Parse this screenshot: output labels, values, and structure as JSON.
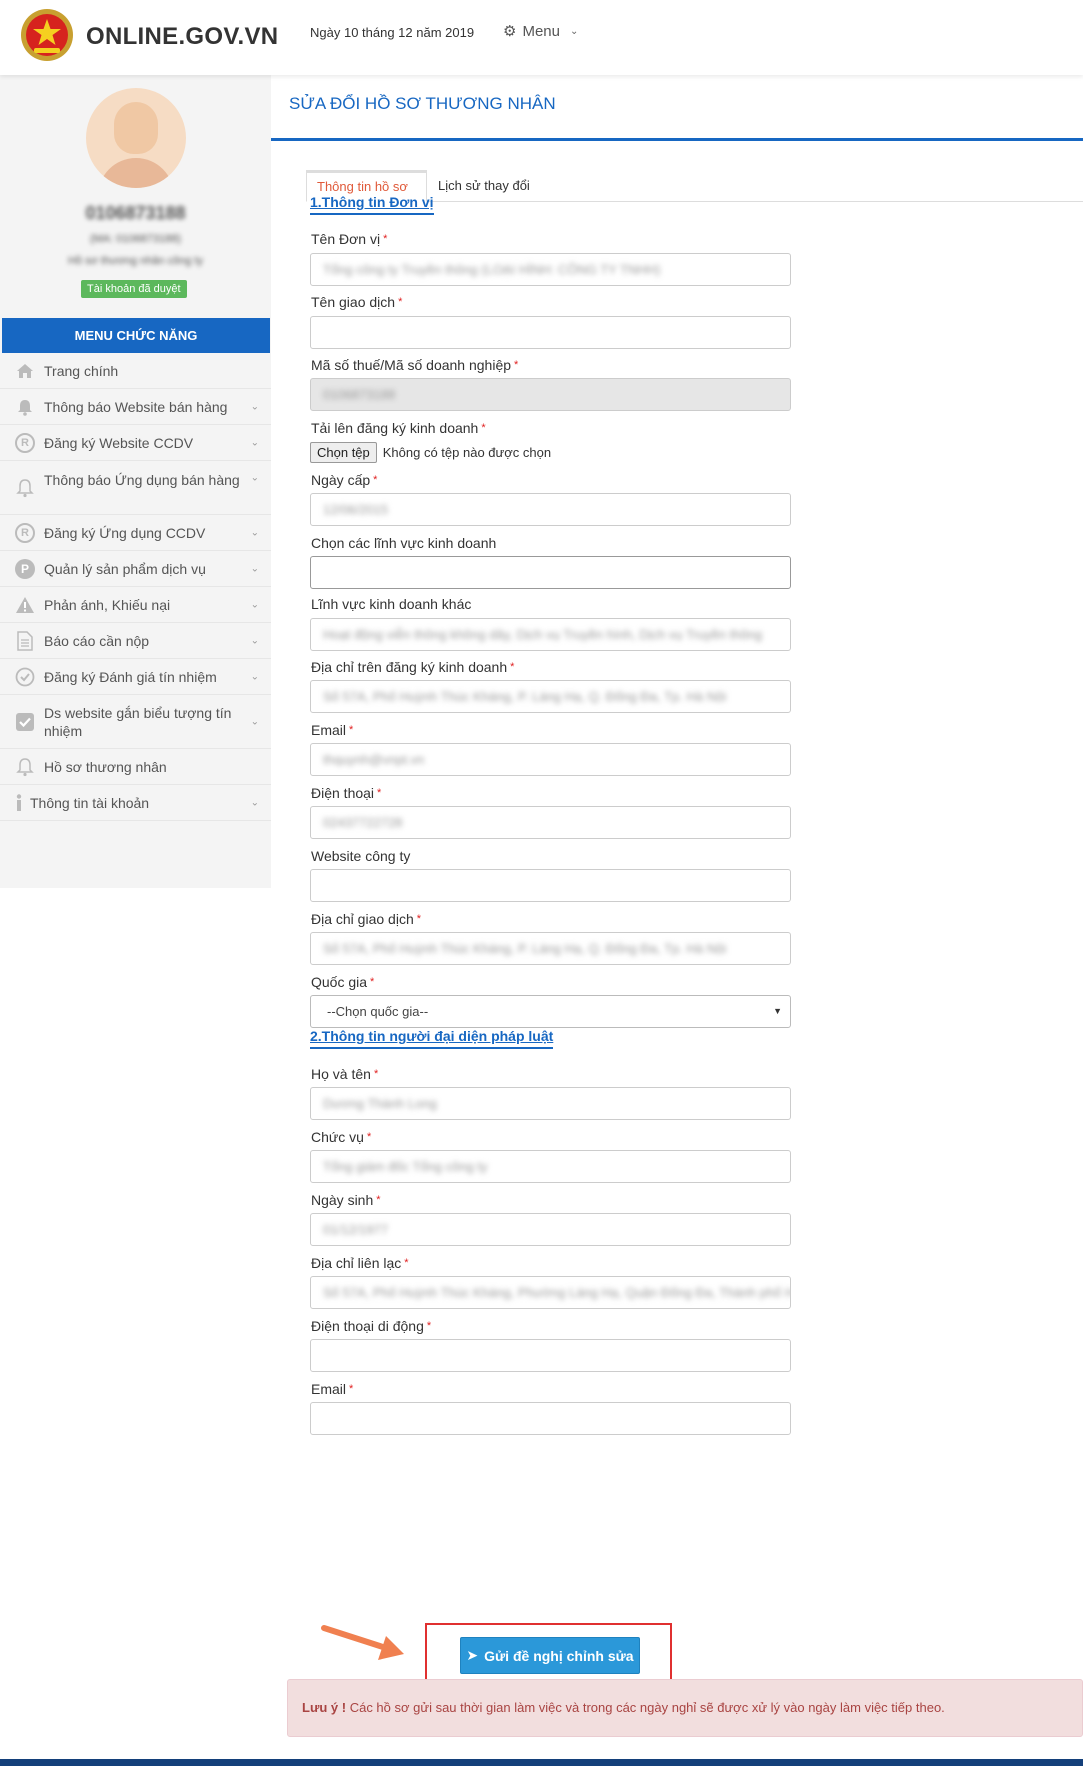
{
  "header": {
    "brand": "ONLINE.GOV.VN",
    "date": "Ngày 10 tháng 12 năm 2019",
    "menu_label": "Menu"
  },
  "sidebar": {
    "user_id": "0106873188",
    "user_sub": "(MA: 0106873188)",
    "user_desc": "Hồ sơ thương nhân công ty",
    "status_badge": "Tài khoản đã duyệt",
    "menu_heading": "MENU CHỨC NĂNG",
    "items": [
      {
        "label": "Trang chính",
        "icon": "home-icon"
      },
      {
        "label": "Thông báo Website bán hàng",
        "icon": "bell-icon"
      },
      {
        "label": "Đăng ký Website CCDV",
        "icon": "registered-icon"
      },
      {
        "label": "Thông báo Ứng dụng bán hàng",
        "icon": "bell-outline-icon"
      },
      {
        "label": "Đăng ký Ứng dụng CCDV",
        "icon": "registered-icon"
      },
      {
        "label": "Quản lý sản phẩm dịch vụ",
        "icon": "product-icon"
      },
      {
        "label": "Phản ánh, Khiếu nại",
        "icon": "warning-icon"
      },
      {
        "label": "Báo cáo cần nộp",
        "icon": "document-icon"
      },
      {
        "label": "Đăng ký Đánh giá tín nhiệm",
        "icon": "check-circle-icon"
      },
      {
        "label": "Ds website gắn biểu tượng tín nhiệm",
        "icon": "checkbox-icon"
      },
      {
        "label": "Hồ sơ thương nhân",
        "icon": "bell-outline-icon"
      },
      {
        "label": "Thông tin tài khoản",
        "icon": "info-icon"
      }
    ]
  },
  "main": {
    "page_title": "SỬA ĐỔI HỒ SƠ THƯƠNG NHÂN",
    "tabs": [
      {
        "label": "Thông tin hồ sơ"
      },
      {
        "label": "Lịch sử thay đổi"
      }
    ],
    "section1_title": "1.Thông tin Đơn vị",
    "section2_title": "2.Thông tin người đại diện pháp luật",
    "fields": {
      "ten_don_vi": {
        "label": "Tên Đơn vị",
        "value": "Tổng công ty Truyền thông (LOẠI HÌNH: CÔNG TY TNHH)"
      },
      "ten_giao_dich": {
        "label": "Tên giao dịch",
        "value": ""
      },
      "ma_so_thue": {
        "label": "Mã số thuế/Mã số doanh nghiệp",
        "value": "0106873188"
      },
      "tai_len": {
        "label": "Tải lên đăng ký kinh doanh",
        "button": "Chọn tệp",
        "status": "Không có tệp nào được chọn"
      },
      "ngay_cap": {
        "label": "Ngày cấp",
        "value": "12/06/2015"
      },
      "linh_vuc": {
        "label": "Chọn các lĩnh vực kinh doanh",
        "value": ""
      },
      "linh_vuc_khac": {
        "label": "Lĩnh vực kinh doanh khác",
        "value": "Hoạt động viễn thông không dây, Dịch vụ Truyền hình, Dịch vụ Truyền thông"
      },
      "dia_chi_dkkd": {
        "label": "Địa chỉ trên đăng ký kinh doanh",
        "value": "Số 57A, Phố Huỳnh Thúc Kháng, P. Láng Hạ, Q. Đống Đa, Tp. Hà Nội"
      },
      "email": {
        "label": "Email",
        "value": "thquynh@vnpt.vn"
      },
      "dien_thoai": {
        "label": "Điện thoại",
        "value": "02437722728"
      },
      "website": {
        "label": "Website công ty",
        "value": ""
      },
      "dia_chi_gd": {
        "label": "Địa chỉ giao dịch",
        "value": "Số 57A, Phố Huỳnh Thúc Kháng, P. Láng Hạ, Q. Đống Đa, Tp. Hà Nội"
      },
      "quoc_gia": {
        "label": "Quốc gia",
        "value": "--Chọn quốc gia--"
      },
      "ho_ten": {
        "label": "Họ và tên",
        "value": "Dương Thành Long"
      },
      "chuc_vu": {
        "label": "Chức vụ",
        "value": "Tổng giám đốc Tổng công ty"
      },
      "ngay_sinh": {
        "label": "Ngày sinh",
        "value": "01/12/1977"
      },
      "dia_chi_lh": {
        "label": "Địa chỉ liên lạc",
        "value": "Số 57A, Phố Huỳnh Thúc Kháng, Phường Láng Hạ, Quận Đống Đa, Thành phố Hà Nội"
      },
      "dt_di_dong": {
        "label": "Điện thoại di động",
        "value": ""
      },
      "email2": {
        "label": "Email",
        "value": ""
      }
    },
    "submit_label": "Gửi đề nghị chỉnh sửa",
    "notice_strong": "Lưu ý !",
    "notice_text": "Các hồ sơ gửi sau thời gian làm việc và trong các ngày nghỉ sẽ được xử lý vào ngày làm việc tiếp theo."
  },
  "colors": {
    "accent": "#1767c2",
    "submit": "#2b98d9",
    "badge": "#5cb85c",
    "highlight": "#e03030",
    "notice_bg": "#f2dede"
  }
}
